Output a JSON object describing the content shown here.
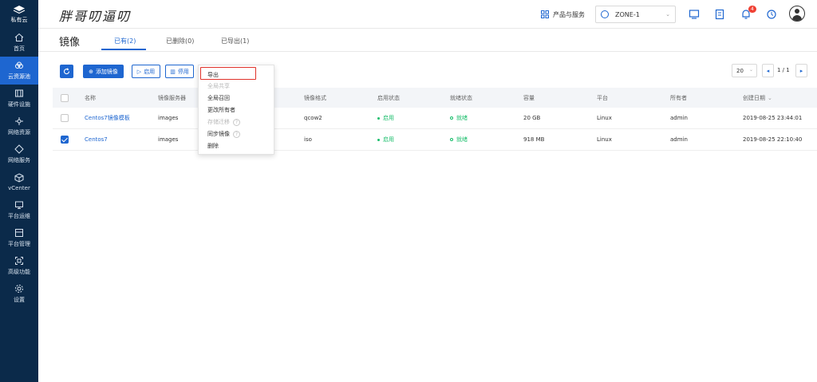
{
  "sidebar": {
    "logo_label": "私有云",
    "items": [
      {
        "label": "首页",
        "icon": "home-icon"
      },
      {
        "label": "云资源池",
        "icon": "cloud-icon"
      },
      {
        "label": "硬件设施",
        "icon": "hardware-icon"
      },
      {
        "label": "网络资源",
        "icon": "network-resource-icon"
      },
      {
        "label": "网络服务",
        "icon": "network-service-icon"
      },
      {
        "label": "vCenter",
        "icon": "vcenter-icon"
      },
      {
        "label": "平台运维",
        "icon": "monitor-icon"
      },
      {
        "label": "平台管理",
        "icon": "platform-manage-icon"
      },
      {
        "label": "高级功能",
        "icon": "advanced-icon"
      },
      {
        "label": "设置",
        "icon": "gear-icon"
      }
    ]
  },
  "topbar": {
    "brand": "胖哥叨逼叨",
    "products_label": "产品与服务",
    "zone": "ZONE-1",
    "notification_count": "4"
  },
  "page": {
    "title": "镜像",
    "tabs": [
      {
        "label": "已有(2)"
      },
      {
        "label": "已删除(0)"
      },
      {
        "label": "已导出(1)"
      }
    ]
  },
  "toolbar": {
    "add_label": "添加镜像",
    "enable_label": "启用",
    "disable_label": "停用"
  },
  "menu": {
    "items": [
      {
        "label": "导出",
        "disabled": false,
        "help": false
      },
      {
        "label": "全局共享",
        "disabled": true,
        "help": false
      },
      {
        "label": "全局召回",
        "disabled": false,
        "help": false
      },
      {
        "label": "更改所有者",
        "disabled": false,
        "help": false
      },
      {
        "label": "存储迁移",
        "disabled": true,
        "help": true
      },
      {
        "label": "同步镜像",
        "disabled": false,
        "help": true
      },
      {
        "label": "删除",
        "disabled": false,
        "help": false
      }
    ],
    "help_glyph": "?"
  },
  "pager": {
    "page_size": "20",
    "page_text": "1 / 1"
  },
  "table": {
    "columns": [
      "名称",
      "镜像服务器",
      "镜像格式",
      "启用状态",
      "就绪状态",
      "容量",
      "平台",
      "所有者",
      "创建日期"
    ],
    "sort_glyph": "⌄",
    "rows": [
      {
        "name": "Centos7镜像模板",
        "server": "images",
        "format": "qcow2",
        "enable": "启用",
        "ready": "就绪",
        "size": "20 GB",
        "platform": "Linux",
        "owner": "admin",
        "created": "2019-08-25 23:44:01",
        "checked": false
      },
      {
        "name": "Centos7",
        "server": "images",
        "format": "iso",
        "enable": "启用",
        "ready": "就绪",
        "size": "918 MB",
        "platform": "Linux",
        "owner": "admin",
        "created": "2019-08-25 22:10:40",
        "checked": true
      }
    ]
  },
  "colors": {
    "sidebar_bg": "#0b2a4a",
    "accent": "#1e66d0",
    "status_green": "#19be6b",
    "highlight_red": "#e0322a"
  }
}
